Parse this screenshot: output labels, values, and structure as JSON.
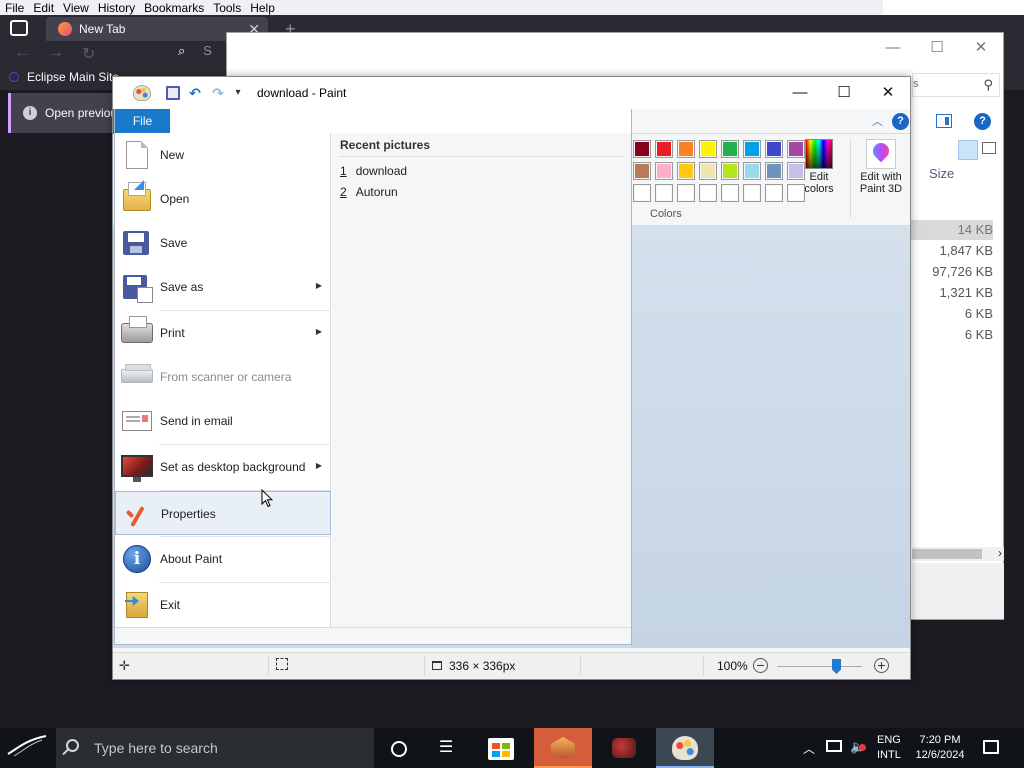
{
  "browser": {
    "menu": [
      "File",
      "Edit",
      "View",
      "History",
      "Bookmarks",
      "Tools",
      "Help"
    ],
    "tab_title": "New Tab",
    "search_partial": "S",
    "bookmark": "Eclipse Main Site",
    "notification": "Open previous"
  },
  "explorer": {
    "size_header": "Size",
    "sizes": [
      "14 KB",
      "1,847 KB",
      "97,726 KB",
      "1,321 KB",
      "6 KB",
      "6 KB"
    ]
  },
  "paint": {
    "title": "download - Paint",
    "file_tab": "File",
    "colors_label": "Colors",
    "edit_colors_label": [
      "Edit",
      "colors"
    ],
    "edit_paint3d_label": [
      "Edit with",
      "Paint 3D"
    ],
    "palette": [
      [
        "#88001b",
        "#ec1c24",
        "#ff7f27",
        "#fff200",
        "#22b14c",
        "#00a2e8",
        "#3f48cc",
        "#a349a4"
      ],
      [
        "#b97a57",
        "#ffaec9",
        "#ffc90e",
        "#efe4b0",
        "#b5e61d",
        "#99d9ea",
        "#7092be",
        "#c8bfe7"
      ],
      [
        "#ffffff",
        "#ffffff",
        "#ffffff",
        "#ffffff",
        "#ffffff",
        "#ffffff",
        "#ffffff",
        "#ffffff"
      ]
    ],
    "status": {
      "image_size": "336 × 336px",
      "zoom": "100%",
      "zoom_fraction": 0.5
    }
  },
  "file_menu": {
    "items": [
      {
        "label": "New",
        "icon": "new-file-icon",
        "arrow": false,
        "disabled": false
      },
      {
        "label": "Open",
        "icon": "open-folder-icon",
        "arrow": false,
        "disabled": false
      },
      {
        "label": "Save",
        "icon": "save-icon",
        "arrow": false,
        "disabled": false
      },
      {
        "label": "Save as",
        "icon": "save-as-icon",
        "arrow": true,
        "disabled": false
      },
      {
        "label": "Print",
        "icon": "printer-icon",
        "arrow": true,
        "disabled": false
      },
      {
        "label": "From scanner or camera",
        "icon": "scanner-icon",
        "arrow": false,
        "disabled": true
      },
      {
        "label": "Send in email",
        "icon": "email-icon",
        "arrow": false,
        "disabled": false
      },
      {
        "label": "Set as desktop background",
        "icon": "desktop-background-icon",
        "arrow": true,
        "disabled": false
      },
      {
        "label": "Properties",
        "icon": "checkmark-icon",
        "arrow": false,
        "disabled": false
      },
      {
        "label": "About Paint",
        "icon": "info-icon",
        "arrow": false,
        "disabled": false
      },
      {
        "label": "Exit",
        "icon": "exit-icon",
        "arrow": false,
        "disabled": false
      }
    ],
    "recent_header": "Recent pictures",
    "recent": [
      {
        "num": "1",
        "name": "download"
      },
      {
        "num": "2",
        "name": "Autorun"
      }
    ]
  },
  "taskbar": {
    "search_placeholder": "Type here to search",
    "lang": [
      "ENG",
      "INTL"
    ],
    "time": "7:20 PM",
    "date": "12/6/2024"
  }
}
